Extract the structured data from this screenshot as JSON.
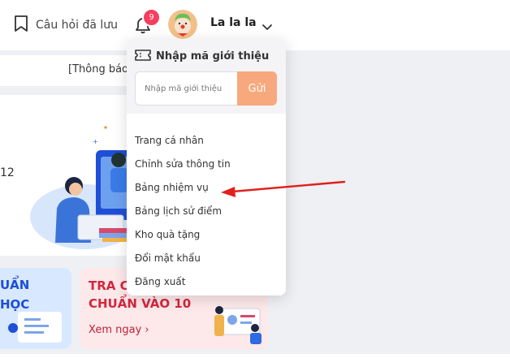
{
  "header": {
    "saved_questions": "Câu hỏi đã lưu",
    "notifications_count": "9",
    "username": "La la la",
    "icons": [
      "bookmark-icon",
      "bell-icon",
      "chevron-down-icon"
    ]
  },
  "background": {
    "notice_text": "[Thông báo",
    "banner_number": "12",
    "card_left": {
      "line1": "UẨN",
      "line2": "HỌC"
    },
    "card_right": {
      "title_line1": "TRA C",
      "title_line2": "CHUẨN VÀO 10",
      "link": "Xem ngay ›"
    }
  },
  "dropdown": {
    "referral_title": "Nhập mã giới thiệu",
    "referral_placeholder": "Nhập mã giới thiệu",
    "send_label": "Gửi",
    "items": [
      "Trang cá nhân",
      "Chỉnh sửa thông tin",
      "Bảng nhiệm vụ",
      "Bảng lịch sử điểm",
      "Kho quà tặng",
      "Đổi mật khẩu",
      "Đăng xuất"
    ]
  },
  "colors": {
    "accent_orange": "#f7a87c",
    "badge_red": "#f43f5e",
    "arrow_red": "#e0201c",
    "card_red_text": "#d4263c",
    "card_blue_text": "#1d4ed8"
  }
}
